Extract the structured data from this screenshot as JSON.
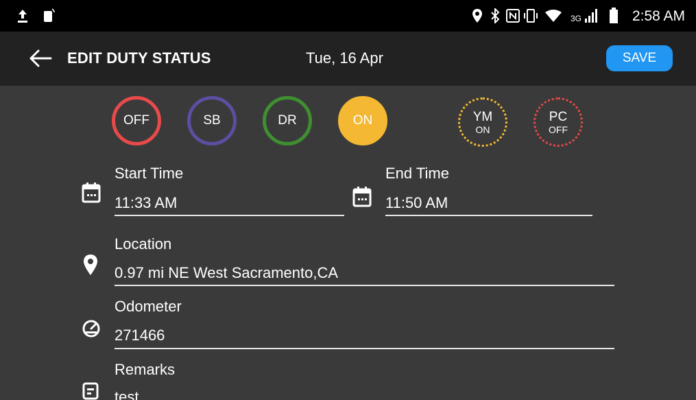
{
  "status_bar": {
    "time": "2:58 AM",
    "icons": [
      "upload-icon",
      "phone-icon",
      "location-icon",
      "bluetooth-icon",
      "nfc-icon",
      "vibrate-icon",
      "wifi-icon",
      "cell-signal-icon",
      "battery-icon"
    ],
    "network": "3G"
  },
  "app_bar": {
    "title": "EDIT DUTY STATUS",
    "date": "Tue, 16 Apr",
    "save_label": "SAVE"
  },
  "duty_status": {
    "buttons": [
      {
        "label": "OFF",
        "color": "#e84a4a",
        "selected": false
      },
      {
        "label": "SB",
        "color": "#5a4fa0",
        "selected": false
      },
      {
        "label": "DR",
        "color": "#3f8f31",
        "selected": false
      },
      {
        "label": "ON",
        "color": "#f4b833",
        "selected": true
      }
    ],
    "toggles": [
      {
        "label": "YM",
        "state": "ON",
        "color": "#f4b833"
      },
      {
        "label": "PC",
        "state": "OFF",
        "color": "#e84a4a"
      }
    ]
  },
  "form": {
    "start_time": {
      "label": "Start Time",
      "value": "11:33 AM"
    },
    "end_time": {
      "label": "End Time",
      "value": "11:50 AM"
    },
    "location": {
      "label": "Location",
      "value": "0.97 mi NE West Sacramento,CA"
    },
    "odometer": {
      "label": "Odometer",
      "value": "271466"
    },
    "remarks": {
      "label": "Remarks",
      "value": "test"
    }
  },
  "colors": {
    "accent": "#2196f3",
    "background": "#3a3a3a",
    "app_bar": "#222222"
  }
}
